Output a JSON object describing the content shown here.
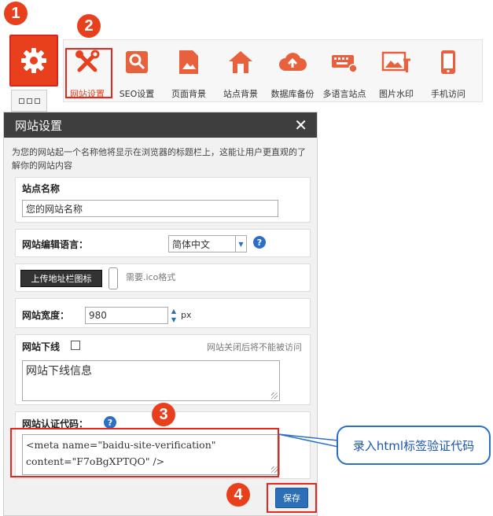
{
  "steps": [
    "1",
    "2",
    "3",
    "4"
  ],
  "toolbar": {
    "items": [
      {
        "label": "网站设置",
        "icon": "wrench-screwdriver-icon"
      },
      {
        "label": "SEO设置",
        "icon": "seo-search-icon"
      },
      {
        "label": "页面背景",
        "icon": "page-image-icon"
      },
      {
        "label": "站点背景",
        "icon": "house-image-icon"
      },
      {
        "label": "数据库备份",
        "icon": "cloud-upload-icon"
      },
      {
        "label": "多语言站点",
        "icon": "keyboard-gear-icon"
      },
      {
        "label": "图片水印",
        "icon": "image-watermark-icon"
      },
      {
        "label": "手机访问",
        "icon": "mobile-phone-icon"
      }
    ]
  },
  "colors": {
    "accent": "#e8401c",
    "dialog_header": "#3e3e3e",
    "link_blue": "#2b6fc7"
  },
  "dialog": {
    "title": "网站设置",
    "intro": "为您的网站起一个名称他将显示在浏览器的标题栏上，这能让用户更直观的了解你的网站内容",
    "site_name": {
      "label": "站点名称",
      "value": "您的网站名称"
    },
    "language": {
      "label": "网站编辑语言：",
      "value": "简体中文"
    },
    "favicon": {
      "button": "上传地址栏图标",
      "hint": "需要.ico格式"
    },
    "width": {
      "label": "网站宽度：",
      "value": "980",
      "unit": "px"
    },
    "offline": {
      "label": "网站下线",
      "hint": "网站关闭后将不能被访问",
      "message": "网站下线信息"
    },
    "verify": {
      "label": "网站认证代码：",
      "code_line1": "<meta name=\"baidu-site-verification\"",
      "code_line2": "content=\"F7oBgXPTQO\" />"
    },
    "save": "保存"
  },
  "callout": "录入html标签验证代码"
}
